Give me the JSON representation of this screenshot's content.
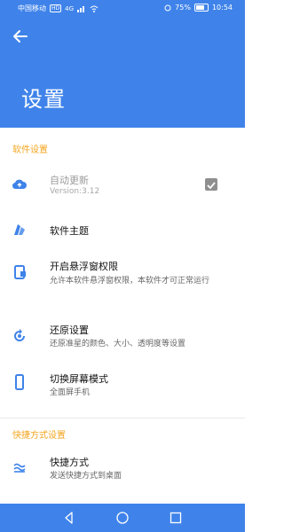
{
  "status_bar": {
    "carrier": "中国移动",
    "network_badge": "HD",
    "signal": "4G",
    "battery": "75%",
    "time": "10:54"
  },
  "header": {
    "title": "设置",
    "background": "#3f83ea"
  },
  "sections": [
    {
      "header": "软件设置",
      "items": [
        {
          "title": "自动更新",
          "subtitle": "Version:3.12",
          "icon": "cloud-upload-icon",
          "checkbox_checked": true,
          "disabled": true
        },
        {
          "title": "软件主题",
          "subtitle": "",
          "icon": "theme-icon"
        },
        {
          "title": "开启悬浮窗权限",
          "subtitle": "允许本软件悬浮窗权限，本软件才可正常运行",
          "icon": "floating-window-icon"
        },
        {
          "title": "还原设置",
          "subtitle": "还原准星的颜色、大小、透明度等设置",
          "icon": "restore-icon"
        },
        {
          "title": "切换屏幕模式",
          "subtitle": "全面屏手机",
          "icon": "phone-icon"
        }
      ]
    },
    {
      "header": "快捷方式设置",
      "items": [
        {
          "title": "快捷方式",
          "subtitle": "发送快捷方式到桌面",
          "icon": "shortcut-icon"
        }
      ]
    }
  ],
  "accent_color": "#f3a51e",
  "nav_bar": {
    "buttons": [
      "back-triangle-icon",
      "home-circle-icon",
      "recent-square-icon"
    ]
  }
}
